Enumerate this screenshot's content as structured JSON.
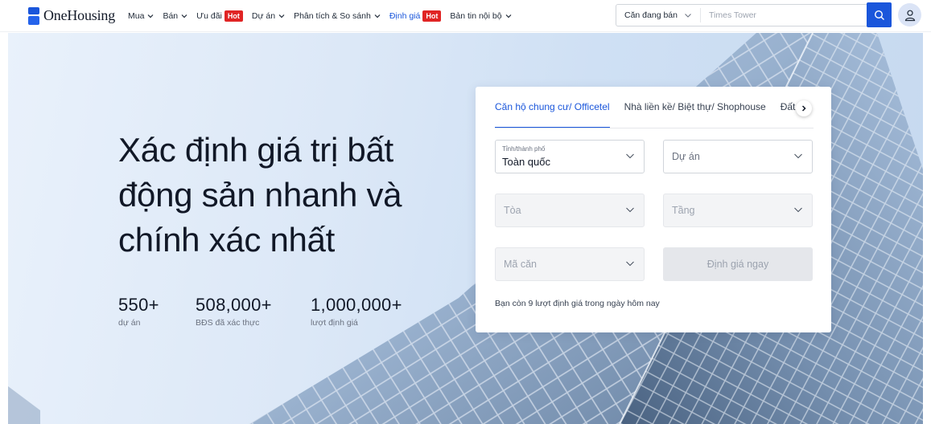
{
  "brand": {
    "name": "OneHousing"
  },
  "nav": {
    "items": [
      {
        "label": "Mua",
        "has_dropdown": true
      },
      {
        "label": "Bán",
        "has_dropdown": true
      },
      {
        "label": "Ưu đãi",
        "badge": "Hot"
      },
      {
        "label": "Dự án",
        "has_dropdown": true
      },
      {
        "label": "Phân tích & So sánh",
        "has_dropdown": true
      },
      {
        "label": "Định giá",
        "badge": "Hot",
        "active": true
      },
      {
        "label": "Bản tin nội bộ",
        "has_dropdown": true
      }
    ]
  },
  "search": {
    "type_label": "Căn đang bán",
    "placeholder": "Times Tower",
    "icon": "search-icon"
  },
  "account": {
    "icon": "user-icon"
  },
  "hero": {
    "title": "Xác định giá trị bất động sản nhanh và chính xác nhất",
    "stats": [
      {
        "value": "550+",
        "label": "dự án"
      },
      {
        "value": "508,000+",
        "label": "BĐS đã xác thực"
      },
      {
        "value": "1,000,000+",
        "label": "lượt định giá"
      }
    ]
  },
  "valuation_form": {
    "tabs": [
      {
        "label": "Căn hộ chung cư/ Officetel",
        "active": true
      },
      {
        "label": "Nhà liền kề/ Biệt thự/ Shophouse",
        "active": false
      },
      {
        "label": "Đất",
        "active": false
      }
    ],
    "next_icon": "chevron-right-icon",
    "city": {
      "label": "Tỉnh/thành phố",
      "value": "Toàn quốc"
    },
    "project": {
      "placeholder": "Dự án"
    },
    "building": {
      "placeholder": "Tòa"
    },
    "floor": {
      "placeholder": "Tầng"
    },
    "unit_code": {
      "placeholder": "Mã căn"
    },
    "submit_label": "Định giá ngay",
    "remaining_text": "Bạn còn 9 lượt định giá trong ngày hôm nay"
  },
  "colors": {
    "primary": "#1a56db",
    "hot_badge": "#e02424",
    "text": "#111827",
    "muted": "#6b7280",
    "hero_bg": "#dce8f7"
  }
}
